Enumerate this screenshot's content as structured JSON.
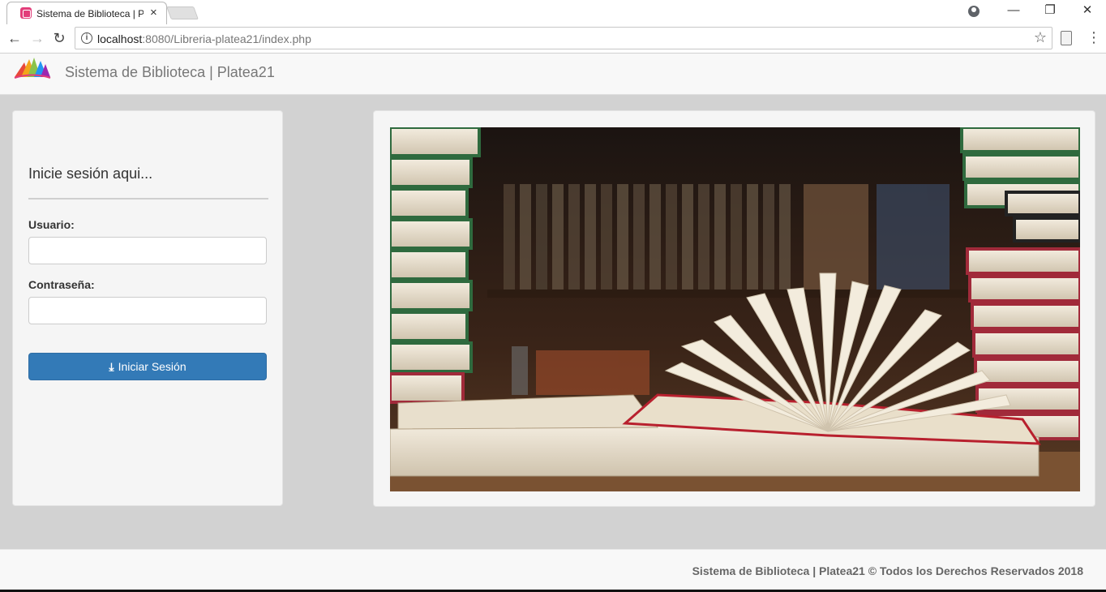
{
  "browser": {
    "tab_title": "Sistema de Biblioteca | Pl",
    "tab_close": "×",
    "url_host": "localhost",
    "url_rest": ":8080/Libreria-platea21/index.php",
    "minimize": "—",
    "restore": "❐",
    "close": "✕",
    "back": "←",
    "forward": "→",
    "reload": "↻",
    "star": "☆",
    "menu": "⋮",
    "info": "i"
  },
  "navbar": {
    "brand": "Sistema de Biblioteca | Platea21"
  },
  "login": {
    "title": "Inicie sesión aqui...",
    "user_label": "Usuario:",
    "user_value": "",
    "password_label": "Contraseña:",
    "password_value": "",
    "button_label": "Iniciar Sesión",
    "button_icon": "⤓"
  },
  "footer": {
    "text": "Sistema de Biblioteca | Platea21 © Todos los Derechos Reservados 2018"
  },
  "colors": {
    "primary": "#337ab7",
    "background": "#d2d2d2",
    "panel": "#f5f5f5"
  }
}
